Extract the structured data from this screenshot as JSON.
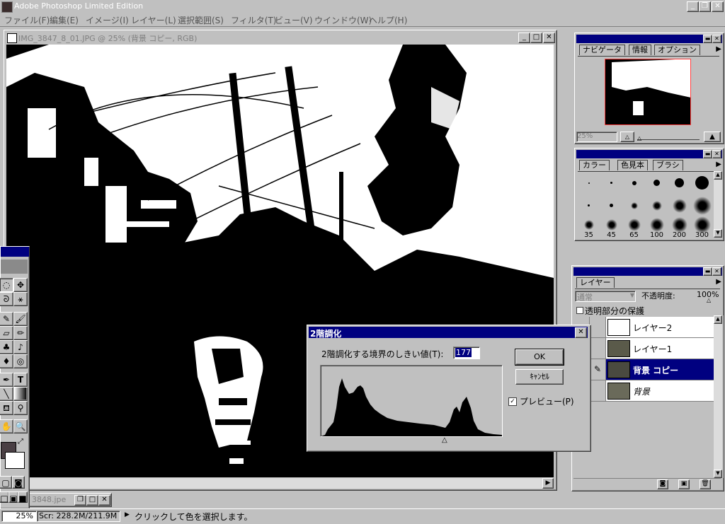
{
  "app": {
    "title": "Adobe Photoshop Limited Edition",
    "window_buttons": [
      "_",
      "❐",
      "✕"
    ]
  },
  "menu": [
    {
      "label": "ファイル(F)"
    },
    {
      "label": "編集(E)"
    },
    {
      "label": "イメージ(I)"
    },
    {
      "label": "レイヤー(L)"
    },
    {
      "label": "選択範囲(S)"
    },
    {
      "label": "フィルタ(T)"
    },
    {
      "label": "ビュー(V)"
    },
    {
      "label": "ウインドウ(W)"
    },
    {
      "label": "ヘルプ(H)"
    }
  ],
  "document": {
    "title": "IMG_3847_8_01.JPG @ 25% (背景 コピー, RGB)",
    "second_title": "3848.jpe"
  },
  "navigator": {
    "tabs": [
      "ナビゲータ",
      "情報",
      "オプション"
    ],
    "zoom": "25%"
  },
  "brushes": {
    "tabs": [
      "カラー",
      "色見本",
      "ブラシ"
    ],
    "sizes": [
      "35",
      "45",
      "65",
      "100",
      "200",
      "300"
    ]
  },
  "layers": {
    "tab": "レイヤー",
    "blend_mode": "通常",
    "opacity_label": "不透明度:",
    "opacity_value": "100%",
    "preserve_label": "透明部分の保護",
    "items": [
      {
        "name": "レイヤー2"
      },
      {
        "name": "レイヤー1"
      },
      {
        "name": "背景 コピー"
      },
      {
        "name": "背景"
      }
    ]
  },
  "dialog": {
    "title": "2階調化",
    "threshold_label": "2階調化する境界のしきい値(T):",
    "threshold_value": "177",
    "ok_label": "OK",
    "cancel_label": "ｷｬﾝｾﾙ",
    "preview_label": "プレビュー(P)",
    "preview_checked": true
  },
  "status": {
    "zoom": "25%",
    "scratch": "Scr: 228.2M/211.9M",
    "message": "クリックして色を選択します。"
  }
}
